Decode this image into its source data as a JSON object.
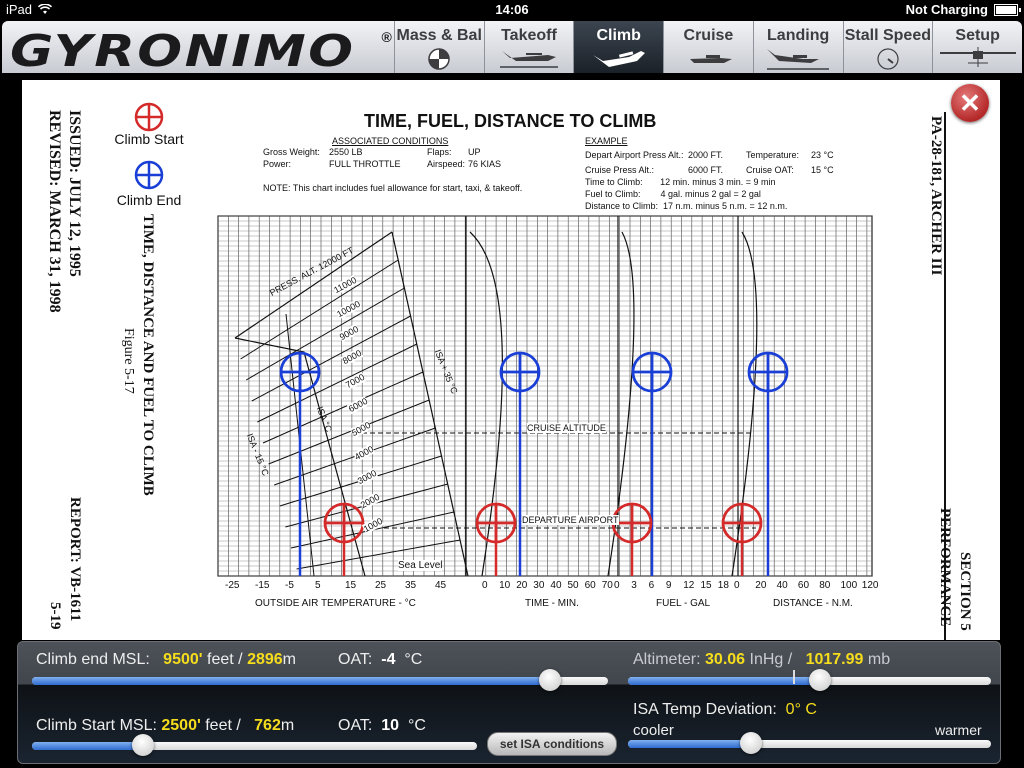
{
  "statusbar": {
    "device": "iPad",
    "time": "14:06",
    "battery_status": "Not Charging"
  },
  "app": {
    "logo": "GYRONIMO",
    "registered": "®"
  },
  "tabs": [
    {
      "label": "Mass & Bal",
      "icon": "cg-icon",
      "active": false
    },
    {
      "label": "Takeoff",
      "icon": "plane-takeoff-icon",
      "active": false
    },
    {
      "label": "Climb",
      "icon": "plane-climb-icon",
      "active": true
    },
    {
      "label": "Cruise",
      "icon": "plane-cruise-icon",
      "active": false
    },
    {
      "label": "Landing",
      "icon": "plane-landing-icon",
      "active": false
    },
    {
      "label": "Stall Speed",
      "icon": "gauge-icon",
      "active": false
    },
    {
      "label": "Setup",
      "icon": "plane-front-icon",
      "active": false
    }
  ],
  "document": {
    "legend": {
      "start": "Climb Start",
      "end": "Climb End",
      "start_color": "#d42a2a",
      "end_color": "#1a3fd6"
    },
    "issued": "ISSUED: JULY 12, 1995",
    "revised": "REVISED: MARCH 31, 1998",
    "figure_title": "TIME, DISTANCE AND FUEL TO CLIMB",
    "figure_num": "Figure 5-17",
    "report": "REPORT: VB-1611",
    "page": "5-19",
    "aircraft": "PA-28-181, ARCHER III",
    "section": "SECTION 5",
    "performance": "PERFORMANCE",
    "chart_title": "TIME, FUEL, DISTANCE TO CLIMB",
    "conditions": {
      "header": "ASSOCIATED CONDITIONS",
      "gross_weight_label": "Gross Weight:",
      "gross_weight": "2550 LB",
      "flaps_label": "Flaps:",
      "flaps": "UP",
      "power_label": "Power:",
      "power": "FULL THROTTLE",
      "airspeed_label": "Airspeed:",
      "airspeed": "76 KIAS",
      "note": "NOTE:  This chart includes fuel allowance for start, taxi, & takeoff."
    },
    "example": {
      "header": "EXAMPLE",
      "depart_label": "Depart Airport Press Alt.:",
      "depart": "2000 FT.",
      "temp_label": "Temperature:",
      "temp": "23 °C",
      "cruise_label": "Cruise Press Alt.:",
      "cruise": "6000 FT.",
      "cruise_oat_label": "Cruise OAT:",
      "cruise_oat": "15 °C",
      "time": "Time to Climb:       12 min. minus 3 min. = 9 min",
      "fuel": "Fuel to Climb:        4 gal. minus 2 gal = 2 gal",
      "distance": "Distance to Climb:  17 n.m. minus 5 n.m. = 12 n.m."
    },
    "chart_labels": {
      "press_alt": "PRESS. ALT. 12000 FT",
      "alts": [
        "11000",
        "10000",
        "9000",
        "8000",
        "7000",
        "6000",
        "5000",
        "4000",
        "3000",
        "2000",
        "1000"
      ],
      "sea_level": "Sea Level",
      "isa_minus": "ISA - 15 °C",
      "isa_zero": "ISA °C",
      "isa_plus": "ISA + 35 °C",
      "cruise_altitude": "CRUISE ALTITUDE",
      "departure_airport": "DEPARTURE AIRPORT"
    },
    "axes": {
      "oat": {
        "label": "OUTSIDE AIR TEMPERATURE - °C",
        "ticks": [
          "-25",
          "-15",
          "-5",
          "5",
          "15",
          "25",
          "35",
          "45"
        ]
      },
      "time": {
        "label": "TIME - MIN.",
        "ticks": [
          "0",
          "10",
          "20",
          "30",
          "40",
          "50",
          "60",
          "70"
        ]
      },
      "fuel": {
        "label": "FUEL - GAL",
        "ticks": [
          "0",
          "3",
          "6",
          "9",
          "12",
          "15",
          "18"
        ]
      },
      "distance": {
        "label": "DISTANCE - N.M.",
        "ticks": [
          "0",
          "20",
          "40",
          "60",
          "80",
          "100",
          "120"
        ]
      }
    }
  },
  "controls": {
    "climb_end": {
      "label": "Climb end MSL:",
      "feet": "9500'",
      "feet_unit": "feet /",
      "meters": "2896",
      "m_unit": "m",
      "oat_label": "OAT:",
      "oat": "-4",
      "oat_unit": "°C",
      "slider_fraction": 0.9
    },
    "climb_start": {
      "label": "Climb Start MSL:",
      "feet": "2500'",
      "feet_unit": "feet /",
      "meters": "762",
      "m_unit": "m",
      "oat_label": "OAT:",
      "oat": "10",
      "oat_unit": "°C",
      "slider_fraction": 0.25
    },
    "altimeter": {
      "label": "Altimeter:",
      "inhg": "30.06",
      "inhg_unit": "InHg /",
      "mb": "1017.99",
      "mb_unit": "mb",
      "slider_fraction": 0.53
    },
    "isa_dev": {
      "label": "ISA Temp Deviation:",
      "value": "0° C",
      "cooler": "cooler",
      "warmer": "warmer",
      "slider_fraction": 0.34
    },
    "set_isa_button": "set ISA conditions"
  }
}
